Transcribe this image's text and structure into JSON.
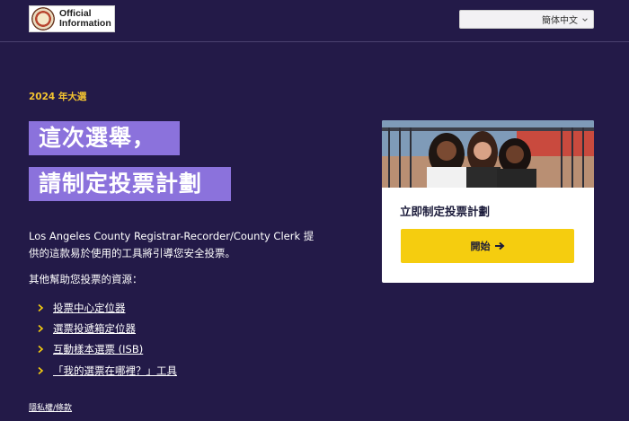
{
  "header": {
    "logo_text_line1": "Official",
    "logo_text_line2": "Information",
    "language_selected": "簡体中文"
  },
  "main": {
    "year_label": "2024 年大選",
    "title_line1": "這次選舉，",
    "title_line2": "請制定投票計劃",
    "description": "Los Angeles County Registrar-Recorder/County Clerk 提供的這款易於使用的工具將引導您安全投票。",
    "resources_label": "其他幫助您投票的資源：",
    "links": [
      {
        "label": "投票中心定位器"
      },
      {
        "label": "選票投遞箱定位器"
      },
      {
        "label": "互動樣本選票 (ISB)"
      },
      {
        "label": "「我的選票在哪裡？」工具"
      }
    ],
    "privacy_link": "隱私權/條款"
  },
  "card": {
    "title": "立即制定投票計劃",
    "button_label": "開始"
  },
  "colors": {
    "background": "#231a48",
    "title_highlight": "#8b72dc",
    "accent_yellow": "#f5cd0f",
    "year_color": "#f4c430"
  }
}
